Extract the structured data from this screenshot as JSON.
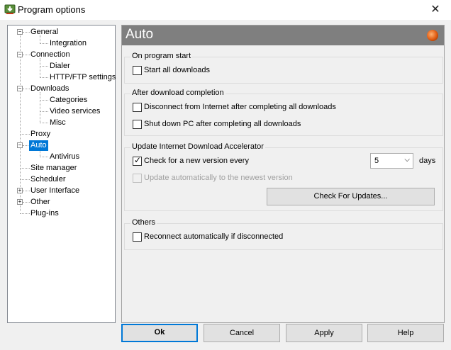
{
  "window": {
    "title": "Program options",
    "close_glyph": "✕"
  },
  "tree": [
    {
      "label": "General",
      "expander": "−"
    },
    {
      "label": "Integration"
    },
    {
      "label": "Connection",
      "expander": "−"
    },
    {
      "label": "Dialer"
    },
    {
      "label": "HTTP/FTP settings"
    },
    {
      "label": "Downloads",
      "expander": "−"
    },
    {
      "label": "Categories"
    },
    {
      "label": "Video services"
    },
    {
      "label": "Misc"
    },
    {
      "label": "Proxy"
    },
    {
      "label": "Auto",
      "expander": "−",
      "selected": true
    },
    {
      "label": "Antivirus"
    },
    {
      "label": "Site manager"
    },
    {
      "label": "Scheduler"
    },
    {
      "label": "User Interface",
      "expander": "+"
    },
    {
      "label": "Other",
      "expander": "+"
    },
    {
      "label": "Plug-ins"
    }
  ],
  "panel": {
    "title": "Auto"
  },
  "groups": {
    "on_start": {
      "legend": "On program start",
      "start_all": {
        "label": "Start all downloads",
        "checked": false
      }
    },
    "after_completion": {
      "legend": "After download completion",
      "disconnect": {
        "label": "Disconnect from Internet after completing all downloads",
        "checked": false
      },
      "shutdown": {
        "label": "Shut down PC after completing all downloads",
        "checked": false
      }
    },
    "update": {
      "legend": "Update Internet Download Accelerator",
      "check_new": {
        "label": "Check for a new version every",
        "checked": true,
        "check_glyph": "✓"
      },
      "interval": {
        "value": "5",
        "arrow": "⌵",
        "unit": "days"
      },
      "auto_update": {
        "label": "Update automatically to the newest version",
        "checked": false,
        "disabled": true
      },
      "check_button": "Check For Updates..."
    },
    "others": {
      "legend": "Others",
      "reconnect": {
        "label": "Reconnect automatically if disconnected",
        "checked": false
      }
    }
  },
  "buttons": {
    "ok": "Ok",
    "cancel": "Cancel",
    "apply": "Apply",
    "help": "Help"
  }
}
